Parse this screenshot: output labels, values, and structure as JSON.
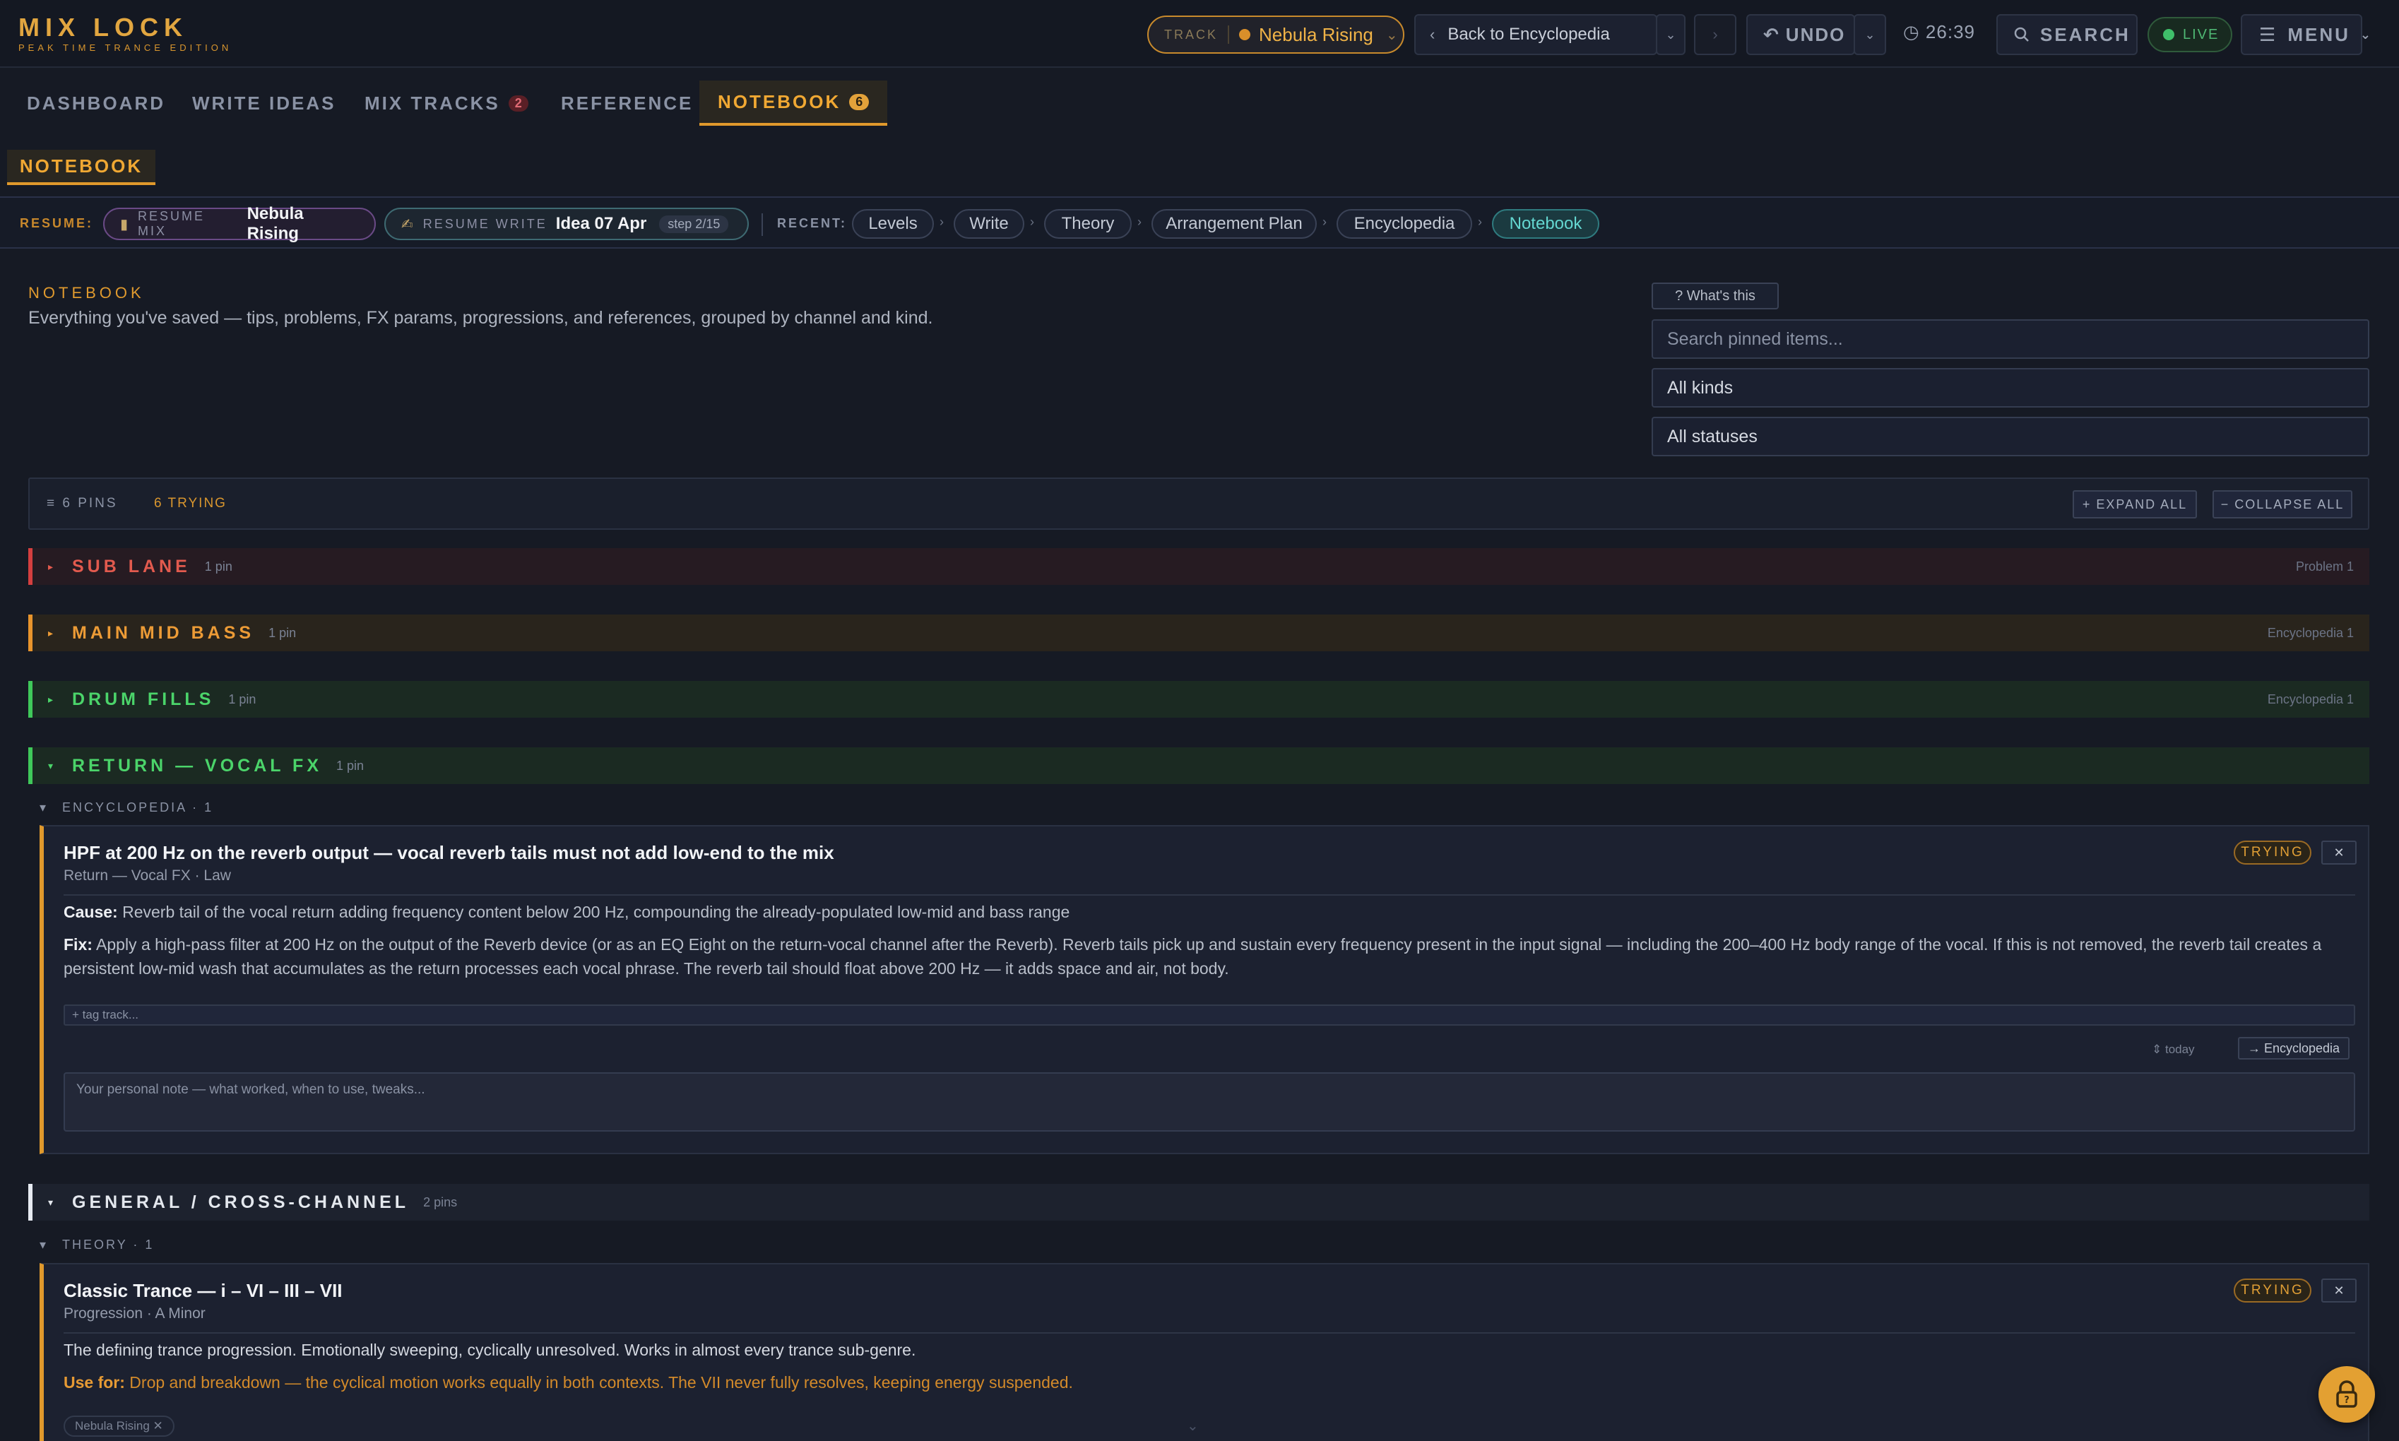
{
  "app": {
    "logo_title": "MIX LOCK",
    "logo_subtitle": "PEAK TIME TRANCE EDITION"
  },
  "topbar": {
    "track_label": "TRACK",
    "track_name": "Nebula Rising",
    "back_label": "Back to Encyclopedia",
    "undo_label": "UNDO",
    "timer": "26:39",
    "search_label": "SEARCH",
    "live_label": "LIVE",
    "menu_label": "MENU"
  },
  "nav": {
    "tabs": [
      {
        "label": "DASHBOARD"
      },
      {
        "label": "WRITE IDEAS"
      },
      {
        "label": "MIX TRACKS",
        "badge": "2"
      },
      {
        "label": "REFERENCE"
      },
      {
        "label": "NOTEBOOK",
        "badge": "6"
      }
    ],
    "subtab": "NOTEBOOK"
  },
  "resume": {
    "label": "RESUME:",
    "mix_kind": "RESUME MIX",
    "mix_value": "Nebula Rising",
    "write_kind": "RESUME WRITE",
    "write_value": "Idea 07 Apr",
    "write_step": "step 2/15",
    "recent_label": "RECENT:",
    "recent": [
      "Levels",
      "Write",
      "Theory",
      "Arrangement Plan",
      "Encyclopedia",
      "Notebook"
    ]
  },
  "notebook": {
    "kicker": "NOTEBOOK",
    "description": "Everything you've saved — tips, problems, FX params, progressions, and references, grouped by channel and kind.",
    "whats_this": "? What's this",
    "search_placeholder": "Search pinned items...",
    "kind_filter": "All kinds",
    "status_filter": "All statuses"
  },
  "stats": {
    "pins": "≡ 6 PINS",
    "trying": "6 TRYING",
    "expand_all": "+ EXPAND ALL",
    "collapse_all": "− COLLAPSE ALL"
  },
  "groups": [
    {
      "name": "SUB LANE",
      "count": "1 pin",
      "kind": "Problem 1",
      "color": "#e25a4e"
    },
    {
      "name": "MAIN MID BASS",
      "count": "1 pin",
      "kind": "Encyclopedia 1",
      "color": "#ec9b36"
    },
    {
      "name": "DRUM FILLS",
      "count": "1 pin",
      "kind": "Encyclopedia 1",
      "color": "#4bd46a"
    },
    {
      "name": "RETURN — VOCAL FX",
      "count": "1 pin",
      "kind": "",
      "color": "#4bd46a"
    },
    {
      "name": "GENERAL / CROSS-CHANNEL",
      "count": "2 pins",
      "kind": "",
      "color": "#e4e8ee"
    }
  ],
  "vox_section": {
    "kind_label": "ENCYCLOPEDIA · 1",
    "card": {
      "title": "HPF at 200 Hz on the reverb output — vocal reverb tails must not add low-end to the mix",
      "meta": "Return — Vocal FX · Law",
      "status": "TRYING",
      "close": "✕",
      "cause_label": "Cause:",
      "cause_text": "Reverb tail of the vocal return adding frequency content below 200 Hz, compounding the already-populated low-mid and bass range",
      "fix_label": "Fix:",
      "fix_text_1": "Apply a high-pass filter at 200 Hz on the output of the Reverb device (or as an EQ Eight on the return-vocal channel after the Reverb). Reverb tails pick up and sustain every frequency present in the input signal — including the 200–400 Hz body range of the vocal. If this is not removed, the reverb tail creates a",
      "fix_text_2": "persistent low-mid wash that accumulates as the return processes each vocal phrase. The reverb tail should float above 200 Hz — it adds space and air, not body.",
      "tag_placeholder": "+ tag track...",
      "saved": "⇕ today",
      "link_label": "→ Encyclopedia",
      "note_placeholder": "Your personal note — what worked, when to use, tweaks..."
    }
  },
  "gen_section": {
    "kind_label": "THEORY · 1",
    "card": {
      "title": "Classic Trance — i – VI – III – VII",
      "meta": "Progression · A Minor",
      "status": "TRYING",
      "close": "✕",
      "body": "The defining trance progression. Emotionally sweeping, cyclically unresolved. Works in almost every trance sub-genre.",
      "use_label": "Use for:",
      "use_text": "Drop and breakdown — the cyclical motion works equally in both contexts. The VII never fully resolves, keeping energy suspended.",
      "track_chip": "Nebula Rising ✕"
    }
  },
  "colors": {
    "accent": "#e0992c",
    "background": "#161a24",
    "live": "#3fbf6a"
  }
}
